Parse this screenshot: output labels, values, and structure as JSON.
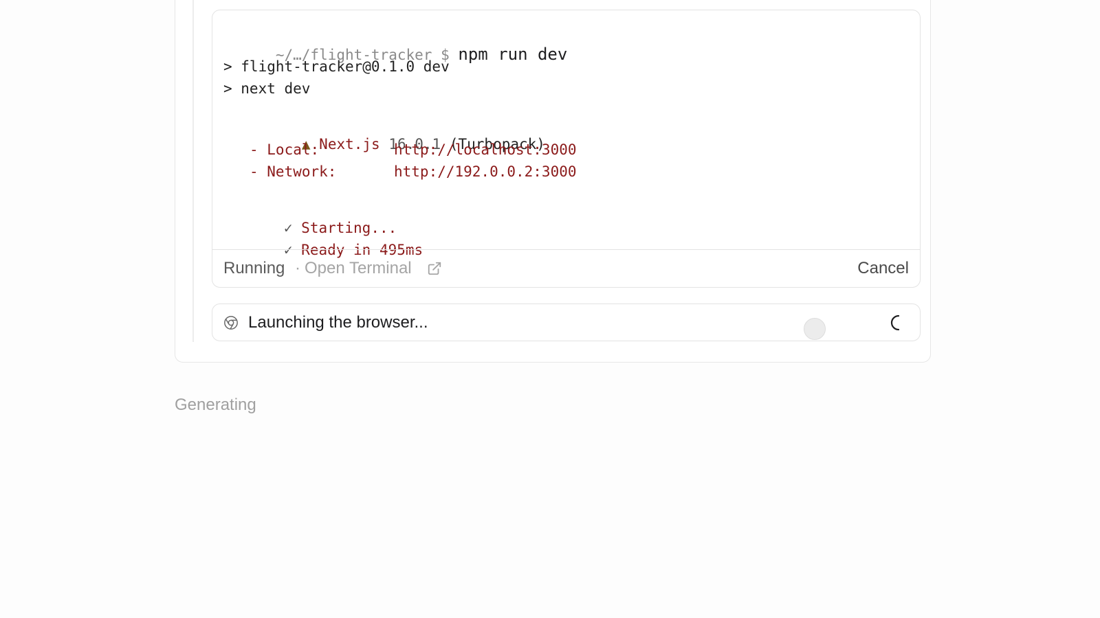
{
  "terminal": {
    "prompt_path": "~/…/flight-tracker $",
    "command": "npm run dev",
    "lines": [
      "> flight-tracker@0.1.0 dev",
      "> next dev"
    ],
    "next_banner": {
      "marker": "▲",
      "name": "Next.js",
      "version": "16.0.1",
      "bundler": "(Turbopack)"
    },
    "local": {
      "label": "- Local:",
      "url": "http://localhost:3000"
    },
    "network": {
      "label": "- Network:",
      "url": "http://192.0.0.2:3000"
    },
    "status_lines": [
      {
        "check": "✓",
        "text": "Starting..."
      },
      {
        "check": "✓",
        "text": "Ready in 495ms"
      }
    ],
    "footer": {
      "status": "Running",
      "separator": "·",
      "open_terminal": "Open Terminal",
      "cancel": "Cancel"
    }
  },
  "browser_task": {
    "text": "Launching the browser...",
    "icon": "browser-icon"
  },
  "generating_text": "Generating"
}
